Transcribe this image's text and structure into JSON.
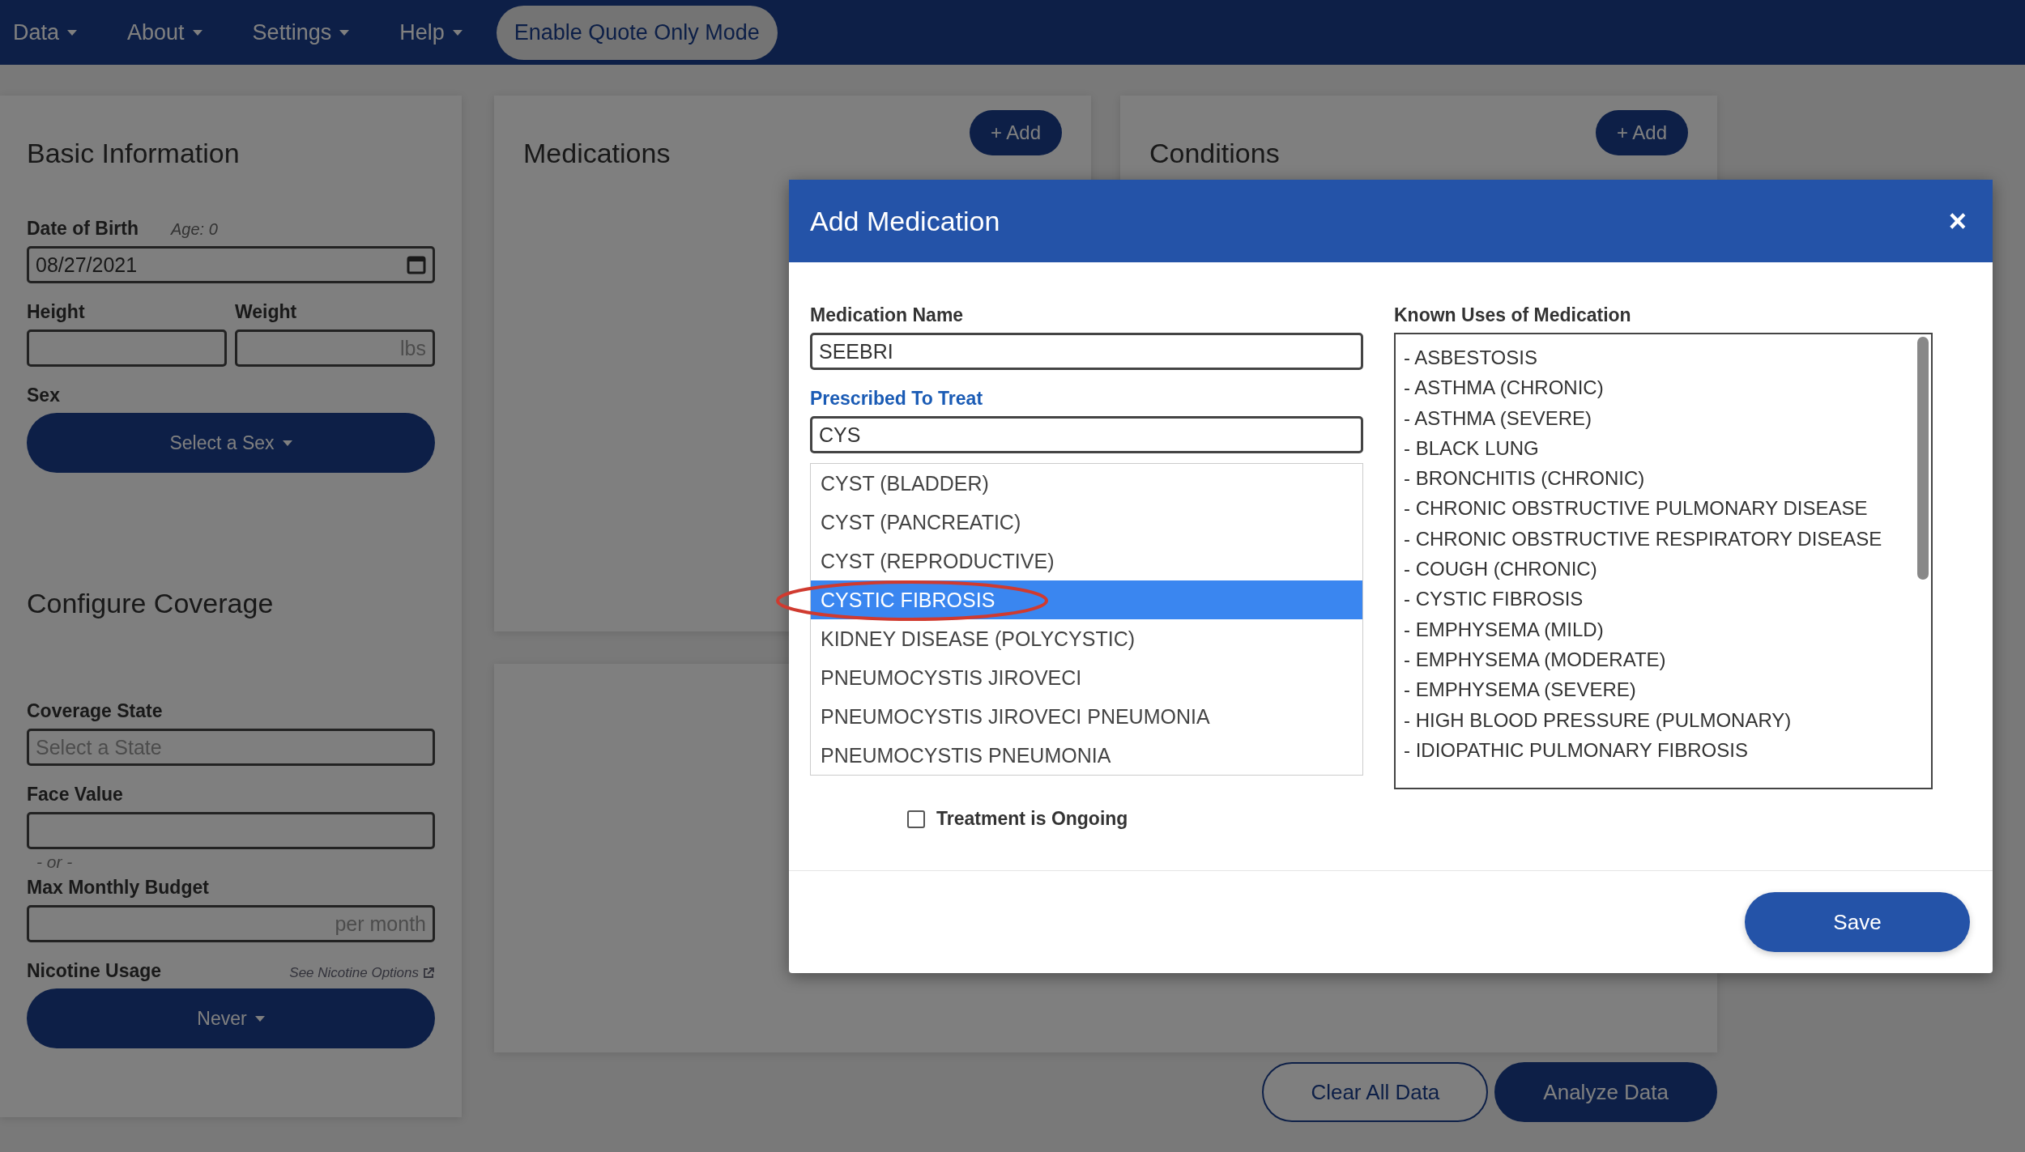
{
  "navbar": {
    "menus": [
      {
        "label": "Data"
      },
      {
        "label": "About"
      },
      {
        "label": "Settings"
      },
      {
        "label": "Help"
      }
    ],
    "quote_button": "Enable Quote Only Mode"
  },
  "basic_information": {
    "title": "Basic Information",
    "date_of_birth": {
      "label": "Date of Birth",
      "age": "Age: 0",
      "value": "08/27/2021"
    },
    "height": {
      "label": "Height"
    },
    "weight": {
      "label": "Weight",
      "placeholder": "lbs"
    },
    "sex": {
      "label": "Sex",
      "button": "Select a Sex"
    }
  },
  "configure_coverage": {
    "title": "Configure Coverage",
    "coverage_state": {
      "label": "Coverage State",
      "placeholder": "Select a State"
    },
    "face_value": {
      "label": "Face Value"
    },
    "separator": "- or -",
    "max_monthly_budget": {
      "label": "Max Monthly Budget",
      "placeholder": "per month"
    },
    "nicotine_usage": {
      "label": "Nicotine Usage",
      "link": "See Nicotine Options",
      "button": "Never"
    }
  },
  "medications": {
    "title": "Medications",
    "add_button": "+ Add"
  },
  "conditions": {
    "title": "Conditions",
    "add_button": "+ Add"
  },
  "actions": [
    {
      "label": "Clear All Data",
      "kind": "outline"
    },
    {
      "label": "Analyze Data",
      "kind": "filled"
    }
  ],
  "modal": {
    "title": "Add Medication",
    "close": "×",
    "medication_name": {
      "label": "Medication Name",
      "value": "SEEBRI"
    },
    "prescribed_to_treat": {
      "label": "Prescribed To Treat",
      "value": "CYS",
      "suggestions": [
        {
          "label": "CYST (BLADDER)",
          "selected": false
        },
        {
          "label": "CYST (PANCREATIC)",
          "selected": false
        },
        {
          "label": "CYST (REPRODUCTIVE)",
          "selected": false
        },
        {
          "label": "CYSTIC FIBROSIS",
          "selected": true
        },
        {
          "label": "KIDNEY DISEASE (POLYCYSTIC)",
          "selected": false
        },
        {
          "label": "PNEUMOCYSTIS JIROVECI",
          "selected": false
        },
        {
          "label": "PNEUMOCYSTIS JIROVECI PNEUMONIA",
          "selected": false
        },
        {
          "label": "PNEUMOCYSTIS PNEUMONIA",
          "selected": false
        }
      ]
    },
    "treatment_ongoing": {
      "label": "Treatment is Ongoing",
      "checked": false
    },
    "known_uses": {
      "label": "Known Uses of Medication",
      "items": [
        "- ASBESTOSIS",
        "- ASTHMA (CHRONIC)",
        "- ASTHMA (SEVERE)",
        "- BLACK LUNG",
        "- BRONCHITIS (CHRONIC)",
        "- CHRONIC OBSTRUCTIVE PULMONARY DISEASE",
        "- CHRONIC OBSTRUCTIVE RESPIRATORY DISEASE",
        "- COUGH (CHRONIC)",
        "- CYSTIC FIBROSIS",
        "- EMPHYSEMA (MILD)",
        "- EMPHYSEMA (MODERATE)",
        "- EMPHYSEMA (SEVERE)",
        "- HIGH BLOOD PRESSURE (PULMONARY)",
        "- IDIOPATHIC PULMONARY FIBROSIS"
      ]
    },
    "save_button": "Save"
  }
}
